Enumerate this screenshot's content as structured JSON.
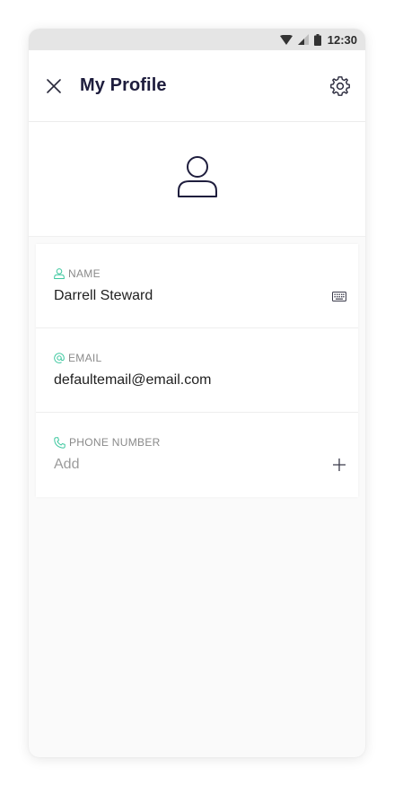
{
  "status_bar": {
    "time": "12:30",
    "icons": [
      "wifi-icon",
      "signal-icon",
      "battery-icon"
    ]
  },
  "app_bar": {
    "title": "My Profile",
    "left_icon": "close-icon",
    "right_icon": "gear-icon"
  },
  "avatar": {
    "icon": "person-icon"
  },
  "fields": [
    {
      "label": "NAME",
      "icon": "person-outline-icon",
      "value": "Darrell Steward",
      "action_icon": "keyboard-icon"
    },
    {
      "label": "EMAIL",
      "icon": "at-icon",
      "value": "defaultemail@email.com"
    },
    {
      "label": "PHONE NUMBER",
      "icon": "phone-icon",
      "placeholder": "Add",
      "action_icon": "plus-icon"
    }
  ],
  "colors": {
    "title": "#1e1d3d",
    "accent": "#3bc79e",
    "status_bar_bg": "#e5e5e5",
    "page_bg": "#fafafa"
  }
}
